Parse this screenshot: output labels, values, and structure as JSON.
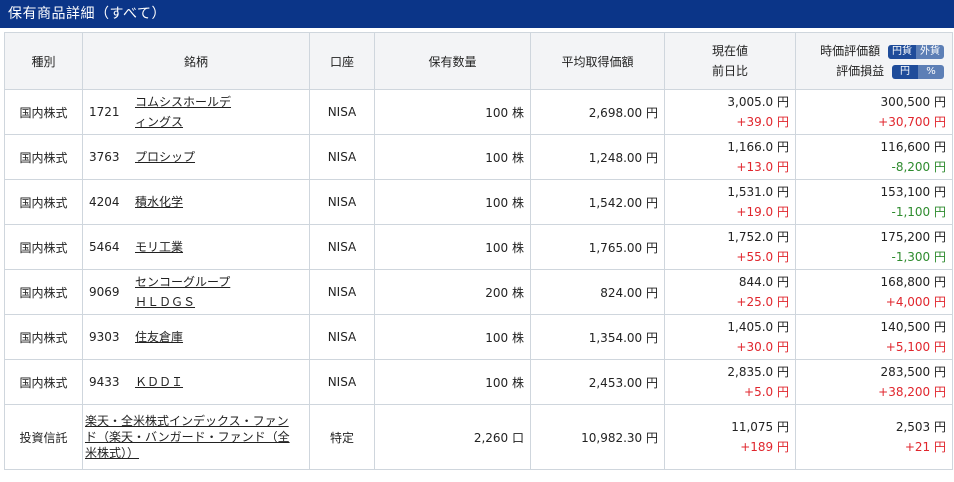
{
  "header": {
    "title": "保有商品詳細（すべて）"
  },
  "columns": {
    "type": "種別",
    "name": "銘柄",
    "account": "口座",
    "quantity": "保有数量",
    "avg_cost": "平均取得価額",
    "price_line1": "現在値",
    "price_line2": "前日比",
    "valuation_line1": "時価評価額",
    "valuation_line2": "評価損益"
  },
  "toggles": {
    "currency": [
      "円貨",
      "外貨"
    ],
    "currency_selected": "円貨",
    "unit": [
      "円",
      "%"
    ],
    "unit_selected": "円"
  },
  "rows": [
    {
      "type": "国内株式",
      "code": "1721",
      "name_1": "コムシスホールデ",
      "name_2": "ィングス",
      "account": "NISA",
      "quantity": "100 株",
      "avg_cost": "2,698.00 円",
      "price": "3,005.0 円",
      "change": "+39.0 円",
      "change_dir": "up",
      "valuation": "300,500 円",
      "pl": "+30,700 円",
      "pl_dir": "up"
    },
    {
      "type": "国内株式",
      "code": "3763",
      "name_1": "プロシップ",
      "name_2": "",
      "account": "NISA",
      "quantity": "100 株",
      "avg_cost": "1,248.00 円",
      "price": "1,166.0 円",
      "change": "+13.0 円",
      "change_dir": "up",
      "valuation": "116,600 円",
      "pl": "-8,200 円",
      "pl_dir": "down"
    },
    {
      "type": "国内株式",
      "code": "4204",
      "name_1": "積水化学",
      "name_2": "",
      "account": "NISA",
      "quantity": "100 株",
      "avg_cost": "1,542.00 円",
      "price": "1,531.0 円",
      "change": "+19.0 円",
      "change_dir": "up",
      "valuation": "153,100 円",
      "pl": "-1,100 円",
      "pl_dir": "down"
    },
    {
      "type": "国内株式",
      "code": "5464",
      "name_1": "モリ工業",
      "name_2": "",
      "account": "NISA",
      "quantity": "100 株",
      "avg_cost": "1,765.00 円",
      "price": "1,752.0 円",
      "change": "+55.0 円",
      "change_dir": "up",
      "valuation": "175,200 円",
      "pl": "-1,300 円",
      "pl_dir": "down"
    },
    {
      "type": "国内株式",
      "code": "9069",
      "name_1": "センコーグループ",
      "name_2": "ＨＬＤＧＳ",
      "account": "NISA",
      "quantity": "200 株",
      "avg_cost": "824.00 円",
      "price": "844.0 円",
      "change": "+25.0 円",
      "change_dir": "up",
      "valuation": "168,800 円",
      "pl": "+4,000 円",
      "pl_dir": "up"
    },
    {
      "type": "国内株式",
      "code": "9303",
      "name_1": "住友倉庫",
      "name_2": "",
      "account": "NISA",
      "quantity": "100 株",
      "avg_cost": "1,354.00 円",
      "price": "1,405.0 円",
      "change": "+30.0 円",
      "change_dir": "up",
      "valuation": "140,500 円",
      "pl": "+5,100 円",
      "pl_dir": "up"
    },
    {
      "type": "国内株式",
      "code": "9433",
      "name_1": "ＫＤＤＩ",
      "name_2": "",
      "account": "NISA",
      "quantity": "100 株",
      "avg_cost": "2,453.00 円",
      "price": "2,835.0 円",
      "change": "+5.0 円",
      "change_dir": "up",
      "valuation": "283,500 円",
      "pl": "+38,200 円",
      "pl_dir": "up"
    }
  ],
  "fund": {
    "type": "投資信託",
    "name_1": "楽天・全米株式インデックス・ファン",
    "name_2": "ド（楽天・バンガード・ファンド（全",
    "name_3": "米株式））",
    "account": "特定",
    "quantity": "2,260 口",
    "avg_cost": "10,982.30 円",
    "price": "11,075 円",
    "change": "+189 円",
    "valuation": "2,503 円",
    "pl": "+21 円"
  }
}
